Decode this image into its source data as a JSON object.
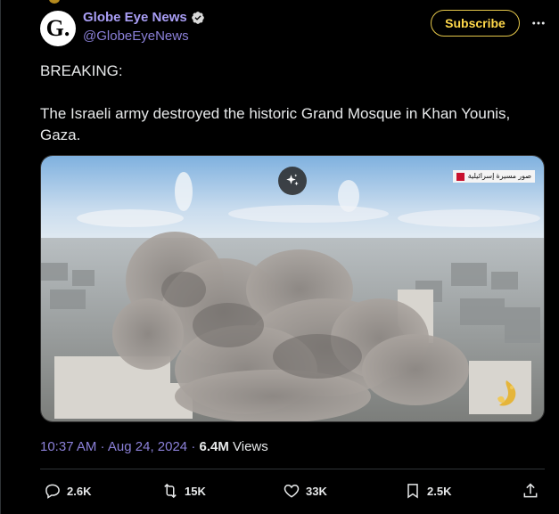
{
  "author": {
    "display_name": "Globe Eye News",
    "handle": "@GlobeEyeNews",
    "avatar_letter": "G.",
    "verified": true
  },
  "header": {
    "subscribe_label": "Subscribe",
    "more_icon": "more-horizontal-icon"
  },
  "post": {
    "line1": "BREAKING:",
    "line2": "The Israeli army destroyed the historic Grand Mosque in Khan Younis, Gaza."
  },
  "media": {
    "source_tag": "صور مسيرة إسرائيلية",
    "grok_icon": "sparkle-icon",
    "watermark": "al-jazeera-logo"
  },
  "meta": {
    "time": "10:37 AM",
    "sep1": " · ",
    "date": "Aug 24, 2024",
    "sep2": " · ",
    "views_count": "6.4M",
    "views_label": " Views"
  },
  "actions": {
    "replies": "2.6K",
    "reposts": "15K",
    "likes": "33K",
    "bookmarks": "2.5K"
  },
  "colors": {
    "background": "#000000",
    "name_purple": "#a99ef5",
    "subscribe_yellow": "#ffd84a",
    "text": "#e7e9ea"
  }
}
